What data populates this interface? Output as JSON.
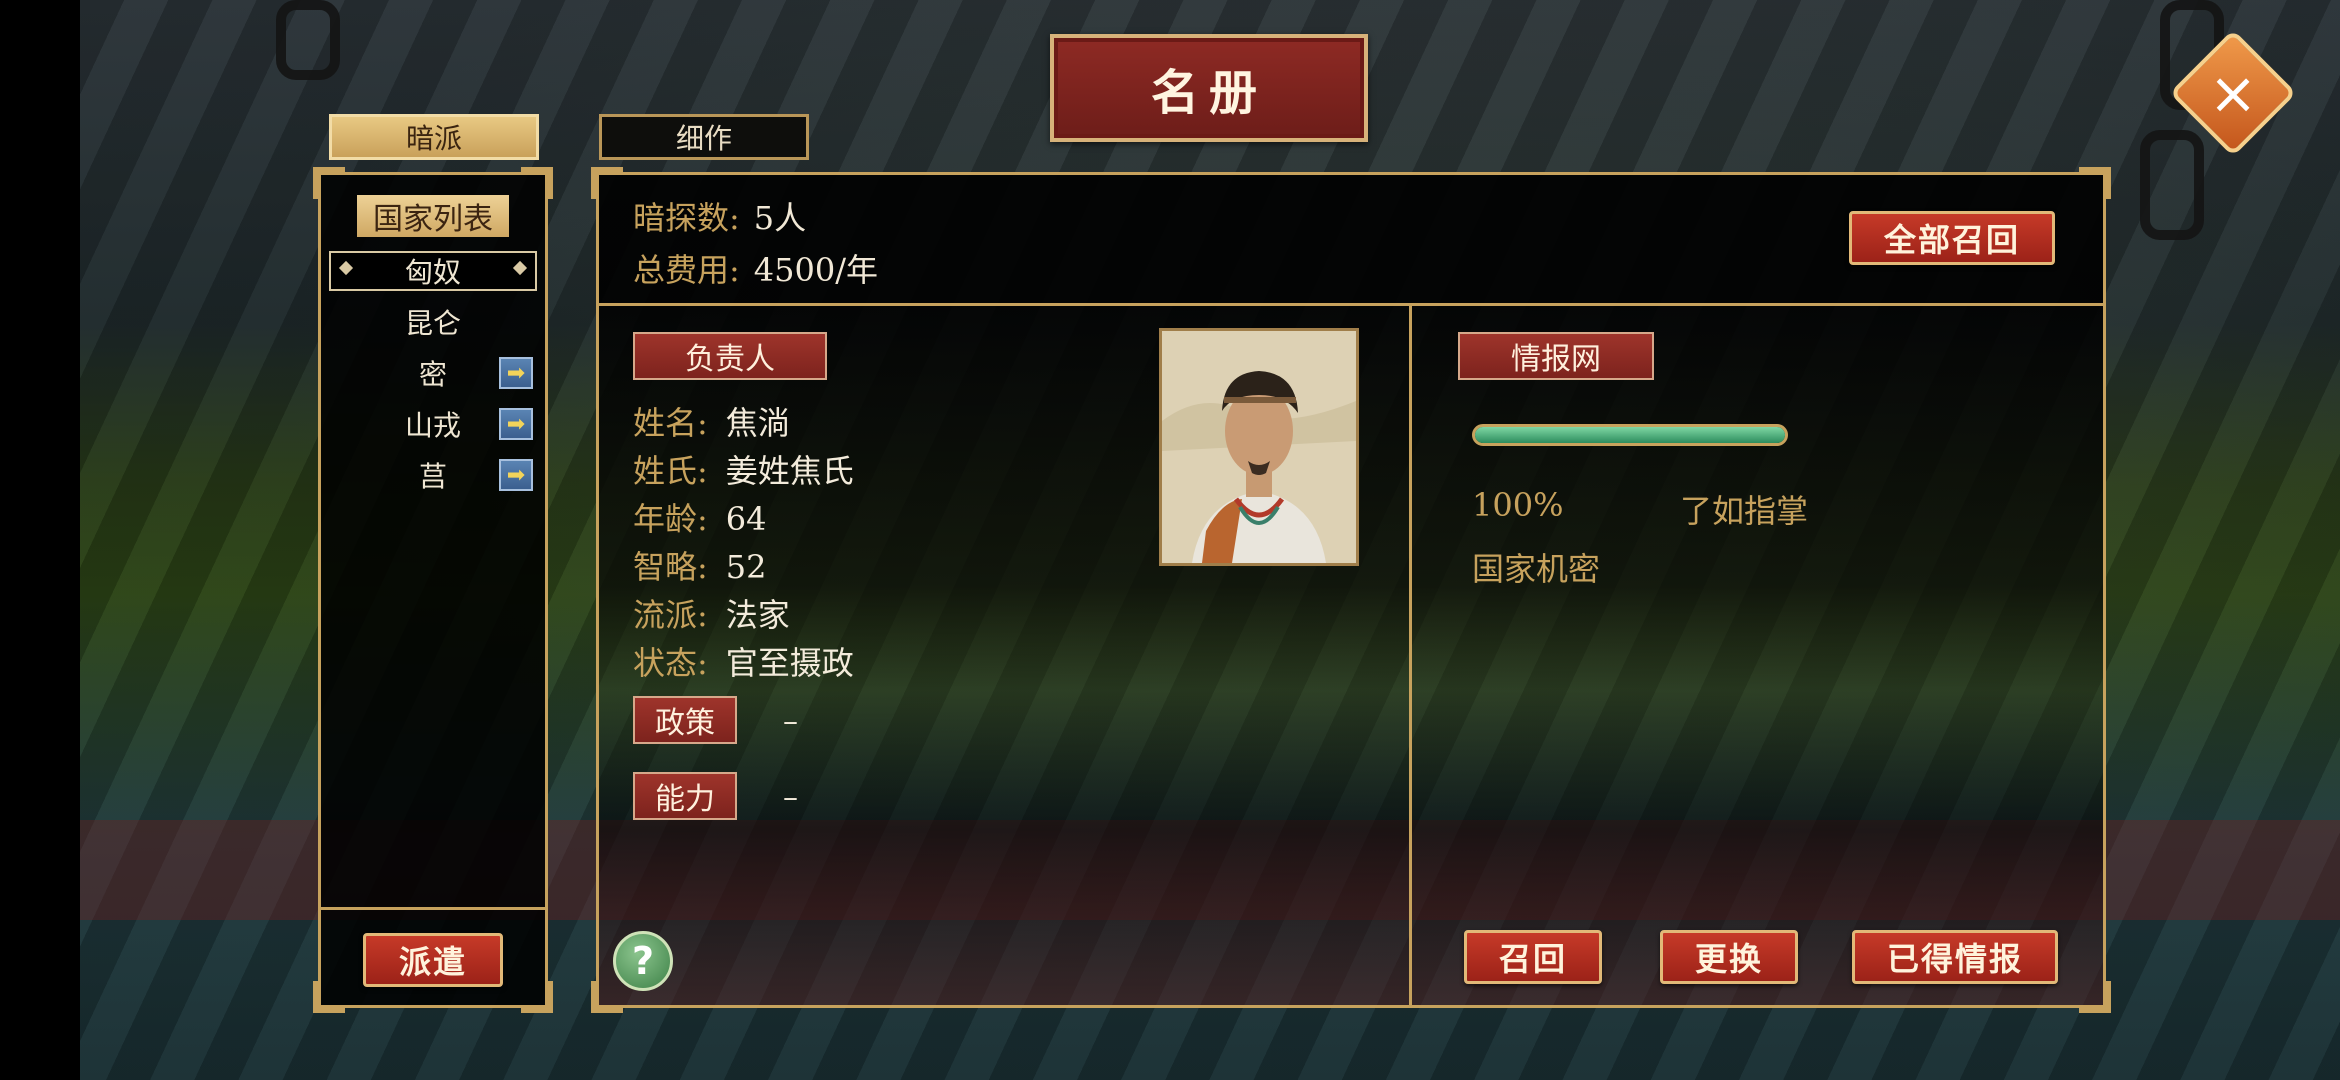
{
  "title": "名册",
  "close_icon": "close-icon",
  "tabs": [
    {
      "label": "暗派",
      "active": true
    },
    {
      "label": "细作",
      "active": false
    }
  ],
  "country_list": {
    "header": "国家列表",
    "items": [
      {
        "label": "匈奴",
        "selected": true,
        "has_arrow": false
      },
      {
        "label": "昆仑",
        "selected": false,
        "has_arrow": false
      },
      {
        "label": "密",
        "selected": false,
        "has_arrow": true
      },
      {
        "label": "山戎",
        "selected": false,
        "has_arrow": true
      },
      {
        "label": "莒",
        "selected": false,
        "has_arrow": true
      }
    ],
    "arrow_icon": "arrow-right-icon"
  },
  "dispatch_label": "派遣",
  "summary": {
    "spy_count_label": "暗探数:",
    "spy_count_value": "5人",
    "total_cost_label": "总费用:",
    "total_cost_value": "4500/年"
  },
  "recall_all_label": "全部召回",
  "manager": {
    "section_label": "负责人",
    "fields": [
      {
        "key": "姓名:",
        "value": "焦淌"
      },
      {
        "key": "姓氏:",
        "value": "姜姓焦氏"
      },
      {
        "key": "年龄:",
        "value": "64"
      },
      {
        "key": "智略:",
        "value": "52"
      },
      {
        "key": "流派:",
        "value": "法家"
      },
      {
        "key": "状态:",
        "value": "官至摄政"
      }
    ],
    "policy_label": "政策",
    "policy_value": "–",
    "ability_label": "能力",
    "ability_value": "–"
  },
  "intel_network": {
    "section_label": "情报网",
    "progress": 1.0,
    "percent_text": "100%",
    "level_text": "了如指掌",
    "detail_text": "国家机密"
  },
  "actions": {
    "recall_label": "召回",
    "replace_label": "更换",
    "intel_label": "已得情报"
  },
  "help_label": "?",
  "colors": {
    "gold": "#c7a25d",
    "red_button": "#b02d20",
    "progress_green": "#4fb07c"
  }
}
